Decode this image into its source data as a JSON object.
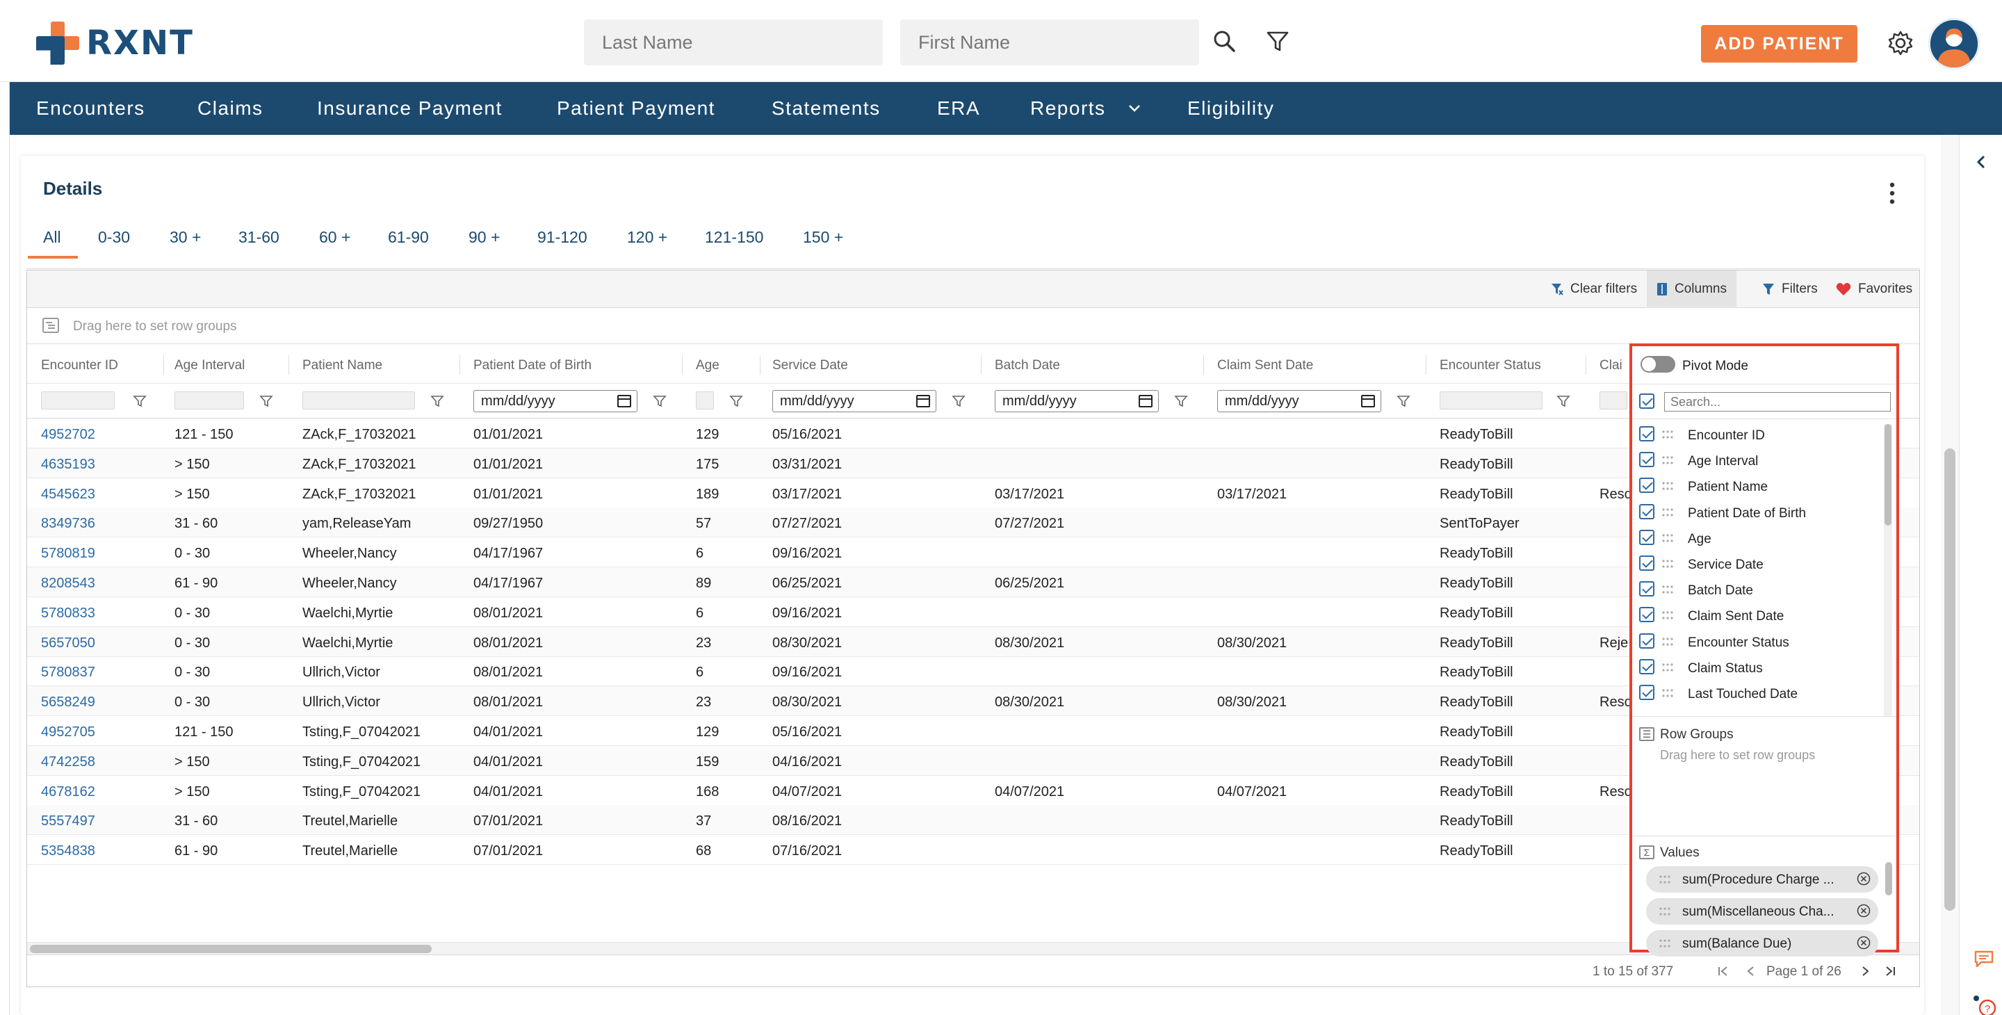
{
  "brand": {
    "name": "RXNT"
  },
  "search": {
    "last_name_placeholder": "Last Name",
    "first_name_placeholder": "First Name"
  },
  "header": {
    "add_patient_label": "ADD PATIENT"
  },
  "nav": {
    "items": [
      "Encounters",
      "Claims",
      "Insurance Payment",
      "Patient Payment",
      "Statements",
      "ERA",
      "Reports",
      "Eligibility"
    ]
  },
  "details": {
    "title": "Details",
    "tabs": [
      "All",
      "0-30",
      "30 +",
      "31-60",
      "60 +",
      "61-90",
      "90 +",
      "91-120",
      "120 +",
      "121-150",
      "150 +"
    ],
    "active_tab": "All"
  },
  "toolbar": {
    "clear_filters": "Clear filters",
    "columns": "Columns",
    "filters": "Filters",
    "favorites": "Favorites"
  },
  "row_groups_hint": "Drag here to set row groups",
  "columns": [
    "Encounter ID",
    "Age Interval",
    "Patient Name",
    "Patient Date of Birth",
    "Age",
    "Service Date",
    "Batch Date",
    "Claim Sent Date",
    "Encounter Status",
    "Clai"
  ],
  "date_placeholder": "mm/dd/yyyy",
  "rows": [
    [
      "4952702",
      "121 - 150",
      "ZAck,F_17032021",
      "01/01/2021",
      "129",
      "05/16/2021",
      "",
      "",
      "ReadyToBill",
      ""
    ],
    [
      "4635193",
      "> 150",
      "ZAck,F_17032021",
      "01/01/2021",
      "175",
      "03/31/2021",
      "",
      "",
      "ReadyToBill",
      ""
    ],
    [
      "4545623",
      "> 150",
      "ZAck,F_17032021",
      "01/01/2021",
      "189",
      "03/17/2021",
      "03/17/2021",
      "03/17/2021",
      "ReadyToBill",
      "Resc"
    ],
    [
      "8349736",
      "31 - 60",
      "yam,ReleaseYam",
      "09/27/1950",
      "57",
      "07/27/2021",
      "07/27/2021",
      "",
      "SentToPayer",
      ""
    ],
    [
      "5780819",
      "0 - 30",
      "Wheeler,Nancy",
      "04/17/1967",
      "6",
      "09/16/2021",
      "",
      "",
      "ReadyToBill",
      ""
    ],
    [
      "8208543",
      "61 - 90",
      "Wheeler,Nancy",
      "04/17/1967",
      "89",
      "06/25/2021",
      "06/25/2021",
      "",
      "ReadyToBill",
      ""
    ],
    [
      "5780833",
      "0 - 30",
      "Waelchi,Myrtie",
      "08/01/2021",
      "6",
      "09/16/2021",
      "",
      "",
      "ReadyToBill",
      ""
    ],
    [
      "5657050",
      "0 - 30",
      "Waelchi,Myrtie",
      "08/01/2021",
      "23",
      "08/30/2021",
      "08/30/2021",
      "08/30/2021",
      "ReadyToBill",
      "Reje"
    ],
    [
      "5780837",
      "0 - 30",
      "Ullrich,Victor",
      "08/01/2021",
      "6",
      "09/16/2021",
      "",
      "",
      "ReadyToBill",
      ""
    ],
    [
      "5658249",
      "0 - 30",
      "Ullrich,Victor",
      "08/01/2021",
      "23",
      "08/30/2021",
      "08/30/2021",
      "08/30/2021",
      "ReadyToBill",
      "Resc"
    ],
    [
      "4952705",
      "121 - 150",
      "Tsting,F_07042021",
      "04/01/2021",
      "129",
      "05/16/2021",
      "",
      "",
      "ReadyToBill",
      ""
    ],
    [
      "4742258",
      "> 150",
      "Tsting,F_07042021",
      "04/01/2021",
      "159",
      "04/16/2021",
      "",
      "",
      "ReadyToBill",
      ""
    ],
    [
      "4678162",
      "> 150",
      "Tsting,F_07042021",
      "04/01/2021",
      "168",
      "04/07/2021",
      "04/07/2021",
      "04/07/2021",
      "ReadyToBill",
      "Resc"
    ],
    [
      "5557497",
      "31 - 60",
      "Treutel,Marielle",
      "07/01/2021",
      "37",
      "08/16/2021",
      "",
      "",
      "ReadyToBill",
      ""
    ],
    [
      "5354838",
      "61 - 90",
      "Treutel,Marielle",
      "07/01/2021",
      "68",
      "07/16/2021",
      "",
      "",
      "ReadyToBill",
      ""
    ]
  ],
  "pager": {
    "summary": "1 to 15 of 377",
    "page_label": "Page 1 of 26"
  },
  "column_panel": {
    "pivot_mode_label": "Pivot Mode",
    "search_placeholder": "Search...",
    "columns": [
      "Encounter ID",
      "Age Interval",
      "Patient Name",
      "Patient Date of Birth",
      "Age",
      "Service Date",
      "Batch Date",
      "Claim Sent Date",
      "Encounter Status",
      "Claim Status",
      "Last Touched Date"
    ],
    "row_groups_title": "Row Groups",
    "row_groups_hint": "Drag here to set row groups",
    "values_title": "Values",
    "values": [
      "sum(Procedure Charge ...",
      "sum(Miscellaneous Cha...",
      "sum(Balance Due)"
    ]
  },
  "colors": {
    "navy": "#1c4a6f",
    "accent": "#f07b3f",
    "link": "#2b6aa5",
    "highlight": "#e8402d"
  }
}
